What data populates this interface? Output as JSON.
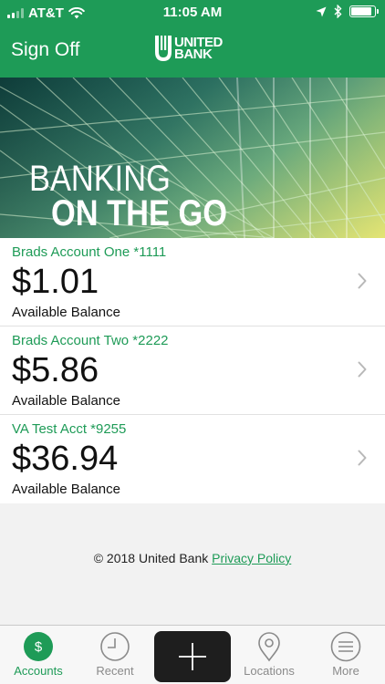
{
  "status_bar": {
    "carrier": "AT&T",
    "time": "11:05 AM"
  },
  "nav": {
    "sign_off_label": "Sign Off",
    "brand_line1": "UNITED",
    "brand_line2": "BANK"
  },
  "hero": {
    "line1": "BANKING",
    "line2": "ON THE GO"
  },
  "accounts": [
    {
      "name": "Brads Account One *1111",
      "balance": "$1.01",
      "balance_label": "Available Balance"
    },
    {
      "name": "Brads Account Two *2222",
      "balance": "$5.86",
      "balance_label": "Available Balance"
    },
    {
      "name": "VA Test Acct *9255",
      "balance": "$36.94",
      "balance_label": "Available Balance"
    }
  ],
  "footer": {
    "copyright": "© 2018 United Bank",
    "privacy_link": "Privacy Policy"
  },
  "tab_bar": {
    "tabs": [
      {
        "label": "Accounts",
        "icon": "dollar-coin-icon",
        "active": true
      },
      {
        "label": "Recent",
        "icon": "clock-icon",
        "active": false
      },
      {
        "label": "",
        "icon": "plus-icon",
        "active": false
      },
      {
        "label": "Locations",
        "icon": "location-pin-icon",
        "active": false
      },
      {
        "label": "More",
        "icon": "menu-icon",
        "active": false
      }
    ]
  },
  "colors": {
    "brand_green": "#1e9b57",
    "add_button": "#1e1e1e",
    "tab_inactive": "#8a8a8a"
  }
}
